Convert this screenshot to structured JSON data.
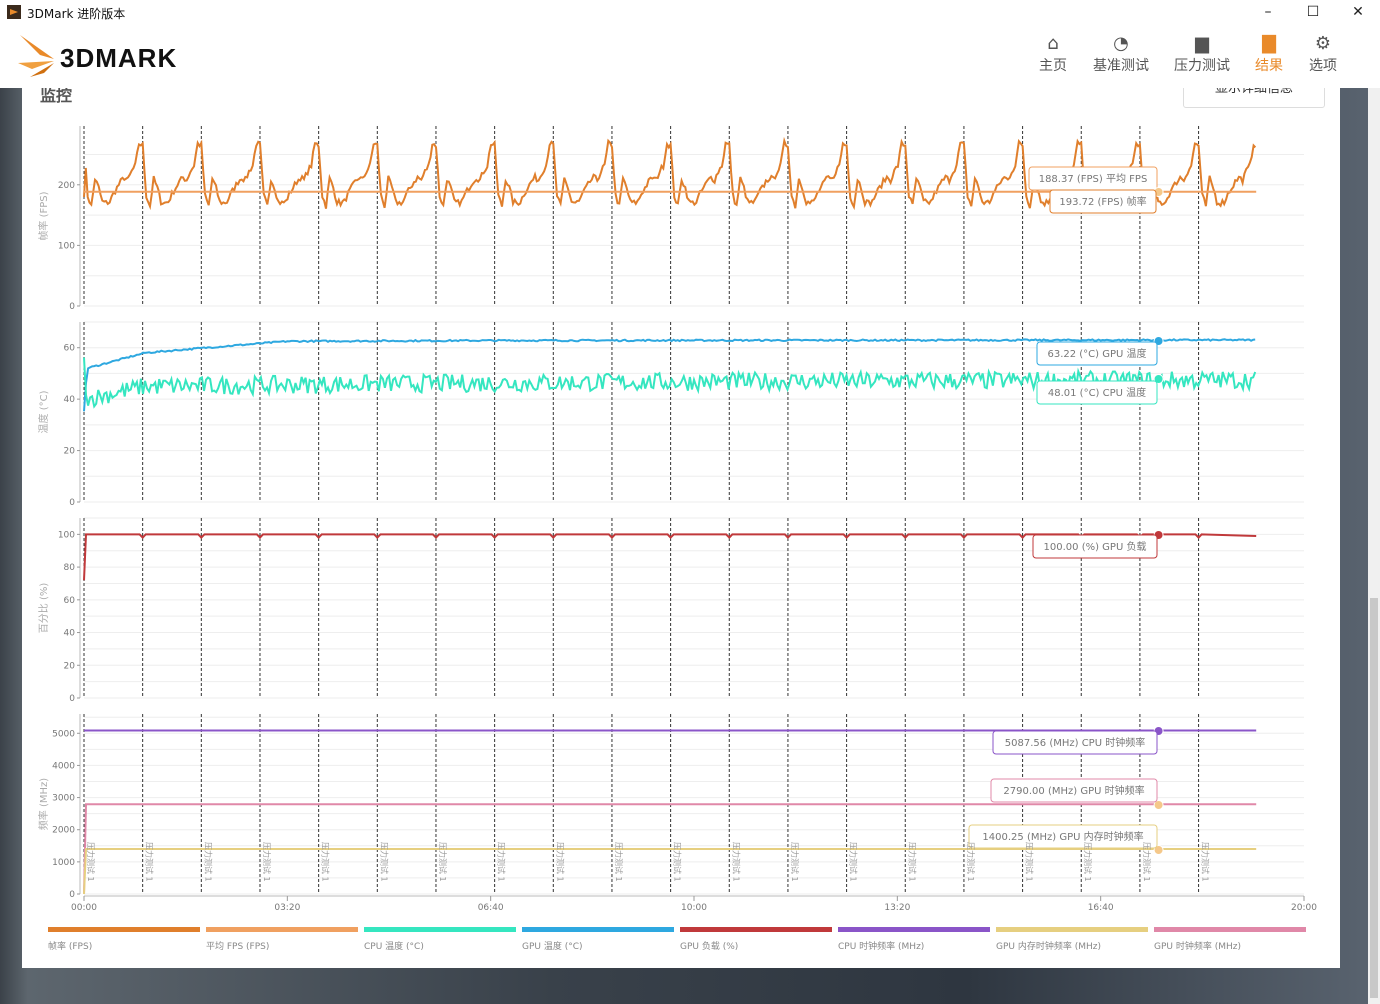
{
  "window": {
    "title": "3DMark 进阶版本",
    "minimize": "–",
    "maximize": "☐",
    "close": "✕"
  },
  "header": {
    "logo_text": "3DMARK",
    "nav": [
      {
        "label": "主页",
        "icon": "home-icon",
        "glyph": "⌂"
      },
      {
        "label": "基准测试",
        "icon": "gauge-icon",
        "glyph": "◔"
      },
      {
        "label": "压力测试",
        "icon": "bar-chart-icon",
        "glyph": "▆"
      },
      {
        "label": "结果",
        "icon": "results-icon",
        "glyph": "▇",
        "active": true
      },
      {
        "label": "选项",
        "icon": "gear-icon",
        "glyph": "⚙"
      }
    ]
  },
  "panel": {
    "title": "监控",
    "detail_button": "显示详细信息"
  },
  "chart_data": {
    "type": "line",
    "x_axis": {
      "range_seconds": [
        0,
        1200
      ],
      "ticks": [
        "00:00",
        "03:20",
        "06:40",
        "10:00",
        "13:20",
        "16:40",
        "20:00"
      ],
      "tick_seconds": [
        0,
        200,
        400,
        600,
        800,
        1000,
        1200
      ]
    },
    "duration_seconds": 1153,
    "loop_seconds": 57.7,
    "loop_count": 20,
    "marker_label": "压力测试 1",
    "hover_seconds": 1055,
    "panels": [
      {
        "ylabel": "帧率 (FPS)",
        "ylim": [
          0,
          297
        ],
        "ticks": [
          0,
          100,
          200
        ],
        "series": [
          {
            "name": "帧率 (FPS)",
            "color": "#e07f2c",
            "loop_pattern": [
              265,
              182,
              165,
              210,
              195,
              172,
              170,
              172,
              185,
              195,
              205,
              212,
              208,
              222,
              232,
              268
            ]
          },
          {
            "name": "平均 FPS (FPS)",
            "color": "#f0a060",
            "constant": 188.37
          }
        ],
        "tooltips": [
          "188.37 (FPS) 平均 FPS",
          "193.72 (FPS) 帧率"
        ]
      },
      {
        "ylabel": "温度 (°C)",
        "ylim": [
          0,
          70
        ],
        "ticks": [
          0,
          20,
          40,
          60
        ],
        "series": [
          {
            "name": "GPU 温度 (°C)",
            "color": "#2ea8e0",
            "keypoints": [
              [
                0,
                35
              ],
              [
                3,
                52
              ],
              [
                60,
                58
              ],
              [
                120,
                60
              ],
              [
                200,
                62.5
              ],
              [
                400,
                62.8
              ],
              [
                1153,
                63
              ]
            ]
          },
          {
            "name": "CPU 温度 (°C)",
            "color": "#35e6c0",
            "keypoints": [
              [
                0,
                55
              ],
              [
                3,
                40
              ],
              [
                60,
                45
              ],
              [
                300,
                46
              ],
              [
                700,
                47
              ],
              [
                1153,
                47.5
              ]
            ],
            "noise": 3.5
          }
        ],
        "tooltips": [
          "63.22 (°C) GPU 温度",
          "48.01 (°C) CPU 温度"
        ]
      },
      {
        "ylabel": "百分比 (%)",
        "ylim": [
          0,
          110
        ],
        "ticks": [
          0,
          20,
          40,
          60,
          80,
          100
        ],
        "series": [
          {
            "name": "GPU 负载 (%)",
            "color": "#c0393b",
            "start": 72,
            "value": 100,
            "loop_dip": 98
          }
        ],
        "tooltips": [
          "100.00 (%) GPU 负载"
        ]
      },
      {
        "ylabel": "频率 (MHz)",
        "ylim": [
          0,
          5600
        ],
        "ticks": [
          0,
          1000,
          2000,
          3000,
          4000,
          5000
        ],
        "series": [
          {
            "name": "CPU 时钟频率 (MHz)",
            "color": "#8a55c8",
            "value": 5087.56
          },
          {
            "name": "GPU 时钟频率 (MHz)",
            "color": "#e088a8",
            "value": 2790.0
          },
          {
            "name": "GPU 内存时钟频率 (MHz)",
            "color": "#e6cf80",
            "value": 1400.25
          }
        ],
        "tooltips": [
          "5087.56 (MHz) CPU 时钟频率",
          "2790.00 (MHz) GPU 时钟频率",
          "1400.25 (MHz) GPU 内存时钟频率"
        ]
      }
    ],
    "legend": [
      {
        "label": "帧率 (FPS)",
        "color": "#e07f2c"
      },
      {
        "label": "平均 FPS (FPS)",
        "color": "#f0a060"
      },
      {
        "label": "CPU 温度 (°C)",
        "color": "#35e6c0"
      },
      {
        "label": "GPU 温度 (°C)",
        "color": "#2ea8e0"
      },
      {
        "label": "GPU 负载 (%)",
        "color": "#c0393b"
      },
      {
        "label": "CPU 时钟频率 (MHz)",
        "color": "#8a55c8"
      },
      {
        "label": "GPU 内存时钟频率 (MHz)",
        "color": "#e6cf80"
      },
      {
        "label": "GPU 时钟频率 (MHz)",
        "color": "#e088a8"
      }
    ]
  }
}
